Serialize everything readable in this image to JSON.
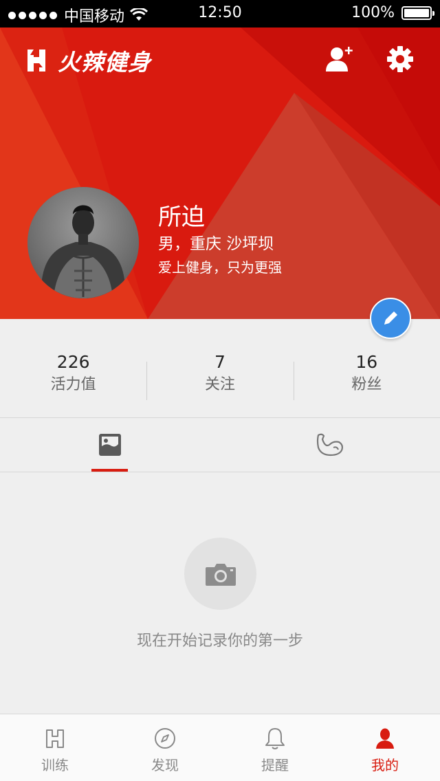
{
  "status_bar": {
    "carrier": "中国移动",
    "time": "12:50",
    "battery": "100%",
    "battery_level": 1.0
  },
  "header": {
    "app_name": "火辣健身",
    "add_friend_icon": "add-user-icon",
    "settings_icon": "gear-icon"
  },
  "profile": {
    "name": "所迫",
    "gender_location": "男，重庆 沙坪坝",
    "bio": "爱上健身，只为更强"
  },
  "stats": [
    {
      "value": "226",
      "label": "活力值"
    },
    {
      "value": "7",
      "label": "关注"
    },
    {
      "value": "16",
      "label": "粉丝"
    }
  ],
  "tabs": [
    {
      "icon": "photo-icon",
      "active": true
    },
    {
      "icon": "muscle-arm-icon",
      "active": false
    }
  ],
  "empty_state": {
    "icon": "camera-icon",
    "text": "现在开始记录你的第一步"
  },
  "bottom_nav": [
    {
      "label": "训练",
      "icon": "training-logo-icon",
      "active": false
    },
    {
      "label": "发现",
      "icon": "compass-icon",
      "active": false
    },
    {
      "label": "提醒",
      "icon": "bell-icon",
      "active": false
    },
    {
      "label": "我的",
      "icon": "person-icon",
      "active": true
    }
  ],
  "colors": {
    "brand_red": "#d81c10",
    "edit_blue": "#3a8ee6",
    "background": "#efefef"
  }
}
